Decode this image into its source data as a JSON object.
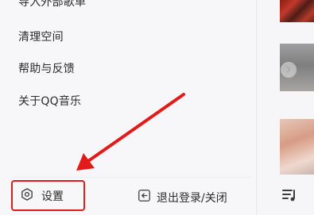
{
  "menu": {
    "partial_item": "导入外部歌单",
    "items": [
      {
        "label": "清理空间"
      },
      {
        "label": "帮助与反馈"
      },
      {
        "label": "关于QQ音乐"
      }
    ],
    "settings_label": "设置",
    "logout_label": "退出登录/关闭"
  },
  "colors": {
    "highlight_red": "#e31a1a",
    "menu_background": "#f7f7f9",
    "text": "#2b2b2b"
  },
  "icons": {
    "settings": "gear-icon",
    "logout": "exit-icon",
    "chevron": "chevron-right-icon",
    "queue": "playlist-icon"
  }
}
